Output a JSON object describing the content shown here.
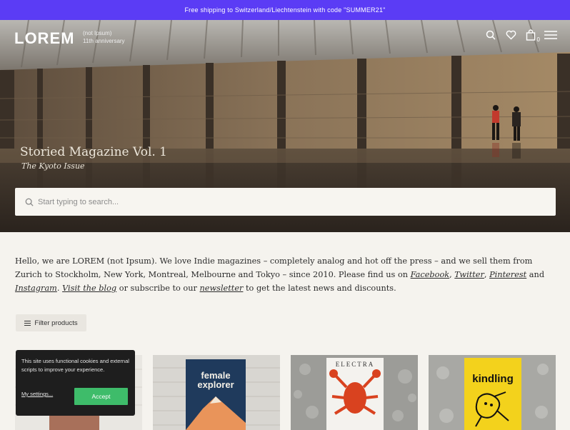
{
  "promo": {
    "text": "Free shipping to Switzerland/Liechtenstein with code \"SUMMER21\""
  },
  "header": {
    "logo": "LOREM",
    "logo_sub_1": "(not Ipsum)",
    "logo_sub_2": "11th anniversary",
    "icons": [
      "search-icon",
      "heart-icon",
      "bag-icon",
      "menu-icon"
    ],
    "cart_count": "0"
  },
  "hero": {
    "title": "Storied Magazine Vol. 1",
    "subtitle": "The Kyoto Issue"
  },
  "search": {
    "placeholder": "Start typing to search..."
  },
  "intro": {
    "p1": "Hello, we are LOREM (not Ipsum). We love Indie magazines – completely analog and hot off the press – and we sell them from Zurich to Stockholm, New York, Montreal, Melbourne and Tokyo – since 2010. Please find us on ",
    "facebook": "Facebook",
    "comma1": ", ",
    "twitter": "Twitter",
    "comma2": ", ",
    "pinterest": "Pinterest",
    "and": " and ",
    "instagram": "Instagram",
    "dot": ". ",
    "blog": "Visit the blog",
    "p2": " or subscribe to our ",
    "newsletter": "newsletter",
    "p3": " to get the latest news and discounts."
  },
  "filter": {
    "label": "Filter products"
  },
  "products": [
    {
      "name": "",
      "cover_title": ""
    },
    {
      "name": "female explorer",
      "cover_title_1": "female",
      "cover_title_2": "explorer"
    },
    {
      "name": "Electra",
      "cover_title": "ELECTRA"
    },
    {
      "name": "kindling",
      "cover_title": "kindling"
    }
  ],
  "cookie": {
    "text": "This site uses functional cookies and external scripts to improve your experience.",
    "settings": "My settings...",
    "accept": "Accept"
  },
  "colors": {
    "promo": "#5b3cf5",
    "accept": "#3ebc6a"
  }
}
